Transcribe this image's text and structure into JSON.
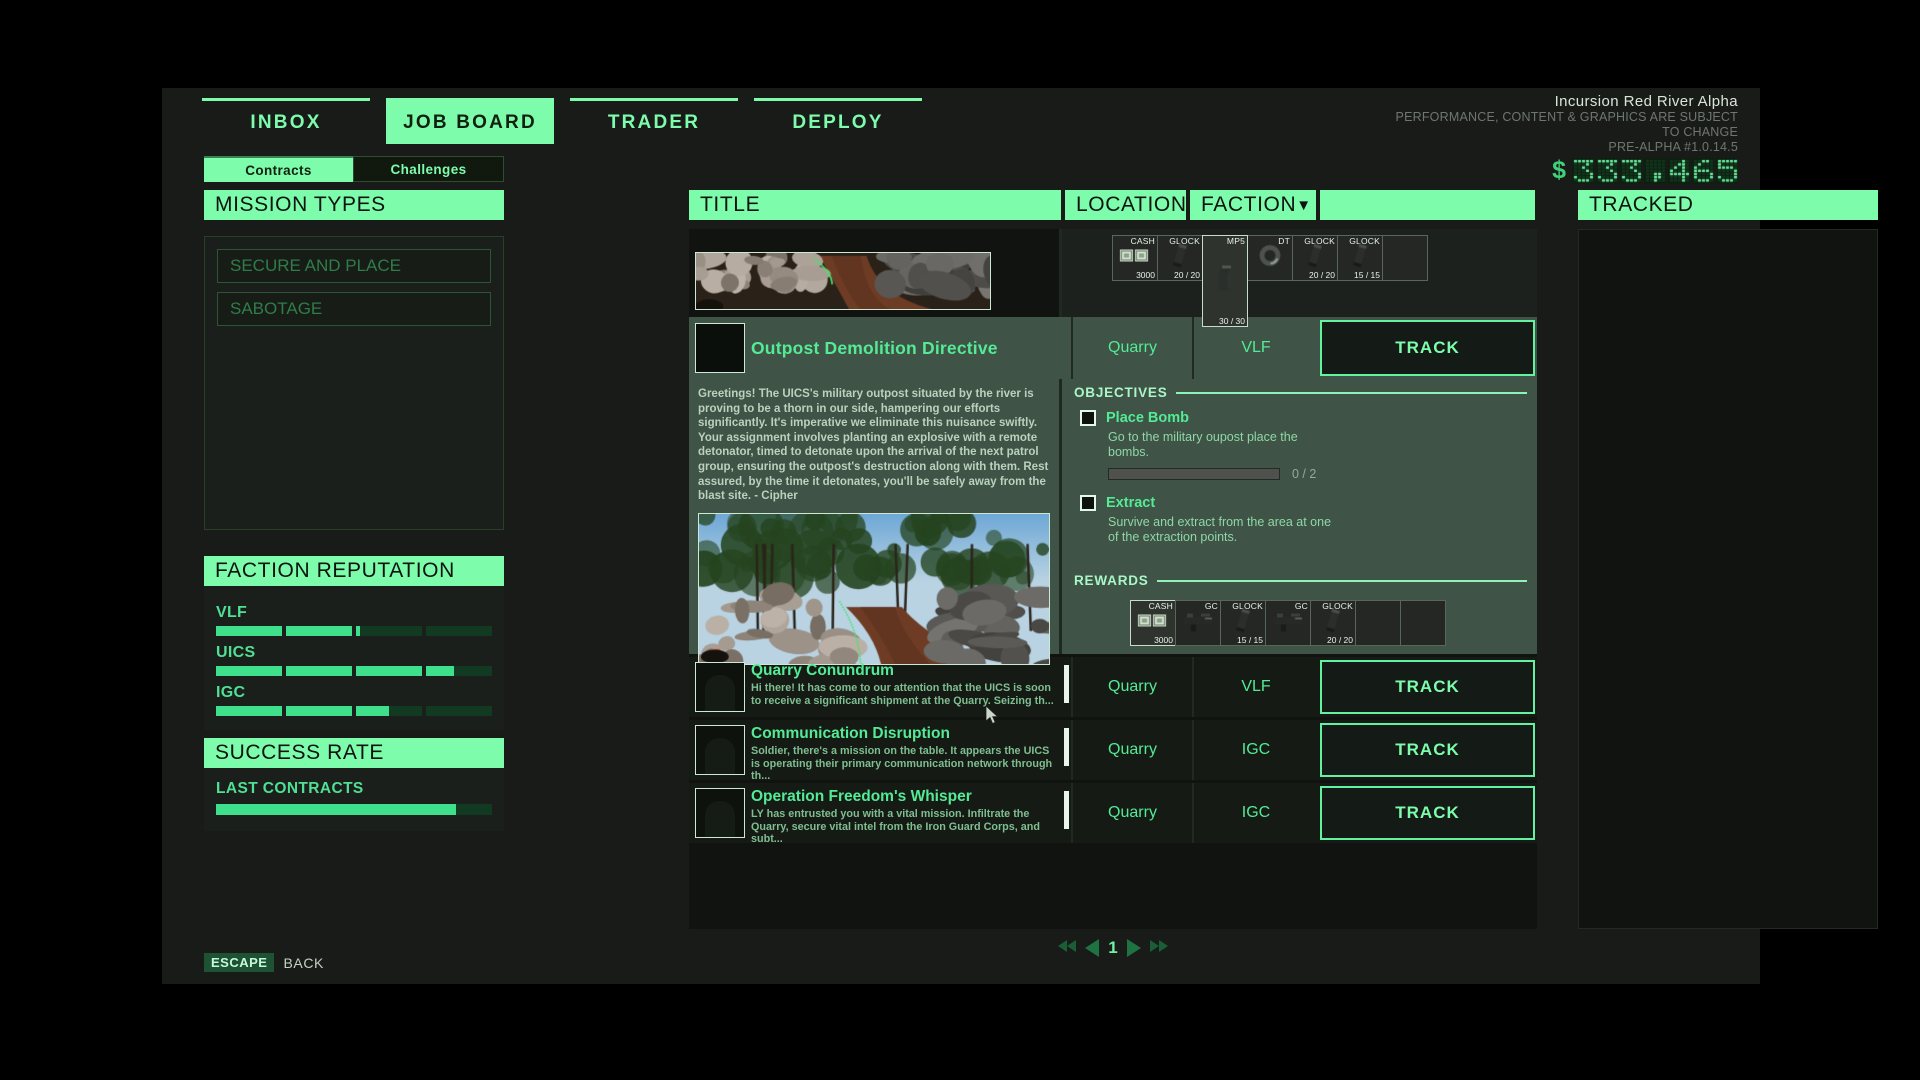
{
  "app": {
    "title": "Incursion Red River Alpha",
    "disclaimer": "PERFORMANCE, CONTENT & GRAPHICS ARE SUBJECT TO CHANGE",
    "version": "PRE-ALPHA #1.0.14.5",
    "currency_symbol": "$",
    "currency_value": "333,465",
    "accent": "#7dfcac",
    "accent_dim": "#3fe08b",
    "panel_bg": "#191b19"
  },
  "tabs": [
    {
      "label": "INBOX",
      "active": false
    },
    {
      "label": "JOB BOARD",
      "active": true
    },
    {
      "label": "TRADER",
      "active": false
    },
    {
      "label": "DEPLOY",
      "active": false
    }
  ],
  "subtabs": [
    {
      "label": "Contracts",
      "selected": true
    },
    {
      "label": "Challenges",
      "selected": false
    }
  ],
  "sidebar": {
    "mission_types": {
      "header": "MISSION TYPES",
      "items": [
        {
          "label": "SECURE AND PLACE"
        },
        {
          "label": "SABOTAGE"
        }
      ]
    },
    "faction_reputation": {
      "header": "FACTION REPUTATION",
      "factions": [
        {
          "name": "VLF",
          "segments": [
            100,
            100,
            6,
            0
          ]
        },
        {
          "name": "UICS",
          "segments": [
            100,
            100,
            100,
            42
          ]
        },
        {
          "name": "IGC",
          "segments": [
            100,
            100,
            50,
            0
          ]
        }
      ]
    },
    "success_rate": {
      "header": "SUCCESS RATE",
      "label": "LAST CONTRACTS",
      "percent": 87
    }
  },
  "columns": {
    "title": "TITLE",
    "location": "LOCATION",
    "faction": "FACTION",
    "faction_caret": "▼",
    "track": ""
  },
  "tracked": {
    "header": "TRACKED",
    "items": []
  },
  "top_partial_row": {
    "rewards": [
      {
        "top": "CASH",
        "bottom": "3000",
        "icon": "cash-icon",
        "tall": false,
        "highlight": false
      },
      {
        "top": "GLOCK",
        "bottom": "20 / 20",
        "icon": "mag-icon",
        "tall": false,
        "highlight": false
      },
      {
        "top": "MP5",
        "bottom": "30 / 30",
        "icon": "mp5mag-icon",
        "tall": true,
        "highlight": true
      },
      {
        "top": "DT",
        "bottom": "",
        "icon": "drum-icon",
        "tall": false,
        "highlight": false
      },
      {
        "top": "GLOCK",
        "bottom": "20 / 20",
        "icon": "mag-icon",
        "tall": false,
        "highlight": false
      },
      {
        "top": "GLOCK",
        "bottom": "15 / 15",
        "icon": "mag-icon",
        "tall": false,
        "highlight": false
      },
      {
        "top": "",
        "bottom": "",
        "icon": "empty-slot",
        "tall": false,
        "highlight": false
      }
    ]
  },
  "selected_mission": {
    "title": "Outpost Demolition Directive",
    "location": "Quarry",
    "faction": "VLF",
    "track_label": "TRACK",
    "description": "Greetings! The UICS's military outpost situated by the river is proving to be a thorn in our side, hampering our efforts significantly. It's imperative we eliminate this nuisance swiftly. Your assignment involves planting an explosive with a remote detonator, timed to detonate upon the arrival of the next patrol group, ensuring the outpost's destruction along with them. Rest assured, by the time it detonates, you'll be safely away from the blast site. - Cipher",
    "objectives_header": "OBJECTIVES",
    "objectives": [
      {
        "name": "Place Bomb",
        "checked": false,
        "description": "Go to the military oupost place the bombs.",
        "progress_text": "0 / 2",
        "progress_percent": 0
      },
      {
        "name": "Extract",
        "checked": false,
        "description": "Survive and extract from the area at one of the extraction points.",
        "progress_text": "",
        "progress_percent": null
      }
    ],
    "rewards_header": "REWARDS",
    "rewards": [
      {
        "top": "CASH",
        "bottom": "3000",
        "icon": "cash-icon",
        "highlight": true
      },
      {
        "top": "GC",
        "bottom": "",
        "icon": "gun-icon",
        "highlight": false
      },
      {
        "top": "GLOCK",
        "bottom": "15 / 15",
        "icon": "mag-icon",
        "highlight": false
      },
      {
        "top": "GC",
        "bottom": "",
        "icon": "gun-icon",
        "highlight": false
      },
      {
        "top": "GLOCK",
        "bottom": "20 / 20",
        "icon": "mag-icon",
        "highlight": false
      },
      {
        "top": "",
        "bottom": "",
        "icon": "empty-slot",
        "highlight": false
      },
      {
        "top": "",
        "bottom": "",
        "icon": "empty-slot",
        "highlight": false
      }
    ]
  },
  "missions": [
    {
      "title": "Quarry Conundrum",
      "description": "Hi there! It has come to our attention that the UICS is soon to receive a significant shipment at the Quarry. Seizing th...",
      "location": "Quarry",
      "faction": "VLF",
      "track_label": "TRACK"
    },
    {
      "title": "Communication Disruption",
      "description": "Soldier, there's a mission on the table. It appears the UICS is operating their primary communication network through th...",
      "location": "Quarry",
      "faction": "IGC",
      "track_label": "TRACK"
    },
    {
      "title": "Operation Freedom's Whisper",
      "description": "LY has entrusted you with a vital mission. Infiltrate the Quarry, secure vital intel from the Iron Guard Corps, and subt...",
      "location": "Quarry",
      "faction": "IGC",
      "track_label": "TRACK"
    }
  ],
  "pagination": {
    "first": "◀◀",
    "prev": "◀",
    "page": "1",
    "next": "▶",
    "last": "▶▶"
  },
  "footer": {
    "key": "ESCAPE",
    "action": "BACK"
  }
}
